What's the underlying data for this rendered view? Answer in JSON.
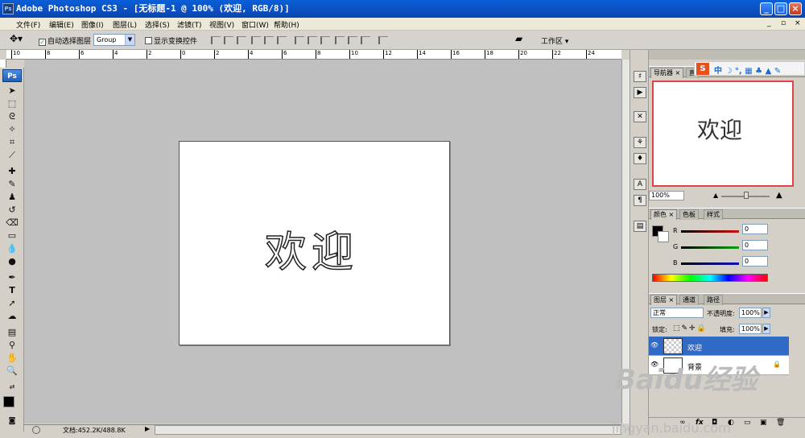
{
  "window": {
    "title": "Adobe Photoshop CS3 - [无标题-1 @ 100% (欢迎, RGB/8)]",
    "app_icon": "Ps",
    "minimize_label": "_",
    "maximize_label": "□",
    "close_label": "×"
  },
  "menubar": {
    "items": [
      "文件(F)",
      "编辑(E)",
      "图像(I)",
      "图层(L)",
      "选择(S)",
      "滤镜(T)",
      "视图(V)",
      "窗口(W)",
      "帮助(H)"
    ],
    "doc_controls": [
      "_",
      "▫",
      "×"
    ]
  },
  "options": {
    "auto_select_label": "自动选择图层",
    "auto_select_checked": true,
    "group_select": "Group",
    "show_transform_label": "显示变换控件",
    "workspace_label": "工作区 ▾"
  },
  "ruler": {
    "h_ticks": [
      "10",
      "8",
      "6",
      "4",
      "2",
      "0",
      "2",
      "4",
      "6",
      "8",
      "10",
      "12",
      "14",
      "16",
      "18",
      "20",
      "22",
      "24"
    ]
  },
  "toolbox": {
    "logo": "Ps"
  },
  "canvas": {
    "text": "欢迎"
  },
  "statusbar": {
    "zoom": "",
    "doc_info": "文档:452.2K/488.8K"
  },
  "navigator": {
    "tabs": [
      "导航器",
      "直"
    ],
    "preview_text": "欢迎",
    "zoom": "100%"
  },
  "ime": {
    "label": "S 中 ☽ °, ▦ ♣ 👕 🔧"
  },
  "color_panel": {
    "tabs": [
      "颜色",
      "色板",
      "样式"
    ],
    "channels": [
      {
        "label": "R",
        "value": "0",
        "color": "#d01010"
      },
      {
        "label": "G",
        "value": "0",
        "color": "#10a010"
      },
      {
        "label": "B",
        "value": "0",
        "color": "#1010c0"
      }
    ]
  },
  "layers_panel": {
    "tabs": [
      "图层",
      "通道",
      "路径"
    ],
    "blend_mode": "正常",
    "opacity_label": "不透明度:",
    "opacity_value": "100%",
    "lock_label": "锁定:",
    "fill_label": "填充:",
    "fill_value": "100%",
    "layers": [
      {
        "name": "欢迎",
        "selected": true
      },
      {
        "name": "背景",
        "selected": false
      }
    ]
  },
  "watermark": {
    "brand": "Baidu经验",
    "url": "jingyan.baidu.com"
  }
}
